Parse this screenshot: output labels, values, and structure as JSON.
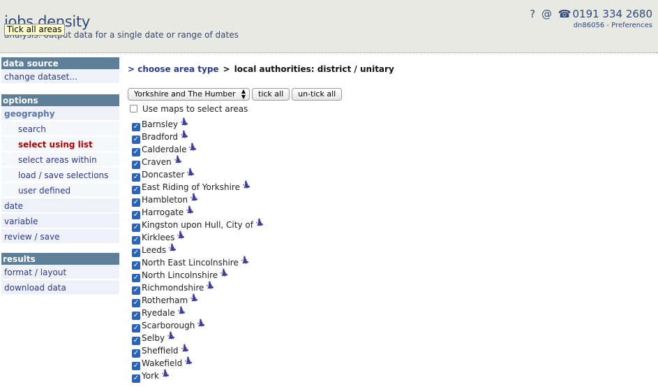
{
  "header": {
    "title": "jobs density",
    "subtitle": "analysis: output data for a single date or range of dates",
    "tooltip": "Tick all areas",
    "help_glyph": "?",
    "email_glyph": "@",
    "phone_glyph": "☎",
    "phone": "0191 334 2680",
    "user": "dn86056",
    "separator": " - ",
    "preferences": "Preferences"
  },
  "sidebar": {
    "data_source": {
      "title": "data source",
      "items": [
        {
          "label": "change dataset..."
        }
      ]
    },
    "options": {
      "title": "options",
      "geography": "geography",
      "sub_items": [
        {
          "label": "search"
        },
        {
          "label": "select using list"
        },
        {
          "label": "select areas within"
        },
        {
          "label": "load / save selections"
        },
        {
          "label": "user defined"
        }
      ],
      "items": [
        {
          "label": "date"
        },
        {
          "label": "variable"
        },
        {
          "label": "review / save"
        }
      ]
    },
    "results": {
      "title": "results",
      "items": [
        {
          "label": "format / layout"
        },
        {
          "label": "download data"
        }
      ]
    }
  },
  "main": {
    "breadcrumb": {
      "link": "> choose area type",
      "sep": ">",
      "current": "local authorities: district / unitary"
    },
    "region_select": "Yorkshire and The Humber",
    "tick_all": "tick all",
    "untick_all": "un-tick all",
    "use_maps": "Use maps to select areas",
    "areas": [
      {
        "name": "Barnsley"
      },
      {
        "name": "Bradford"
      },
      {
        "name": "Calderdale"
      },
      {
        "name": "Craven"
      },
      {
        "name": "Doncaster"
      },
      {
        "name": "East Riding of Yorkshire"
      },
      {
        "name": "Hambleton"
      },
      {
        "name": "Harrogate"
      },
      {
        "name": "Kingston upon Hull, City of"
      },
      {
        "name": "Kirklees"
      },
      {
        "name": "Leeds"
      },
      {
        "name": "North East Lincolnshire"
      },
      {
        "name": "North Lincolnshire"
      },
      {
        "name": "Richmondshire"
      },
      {
        "name": "Rotherham"
      },
      {
        "name": "Ryedale"
      },
      {
        "name": "Scarborough"
      },
      {
        "name": "Selby"
      },
      {
        "name": "Sheffield"
      },
      {
        "name": "Wakefield"
      },
      {
        "name": "York"
      }
    ]
  },
  "colors": {
    "accent": "#2b3a8e",
    "active": "#b00000",
    "section_header": "#5f7f99"
  }
}
